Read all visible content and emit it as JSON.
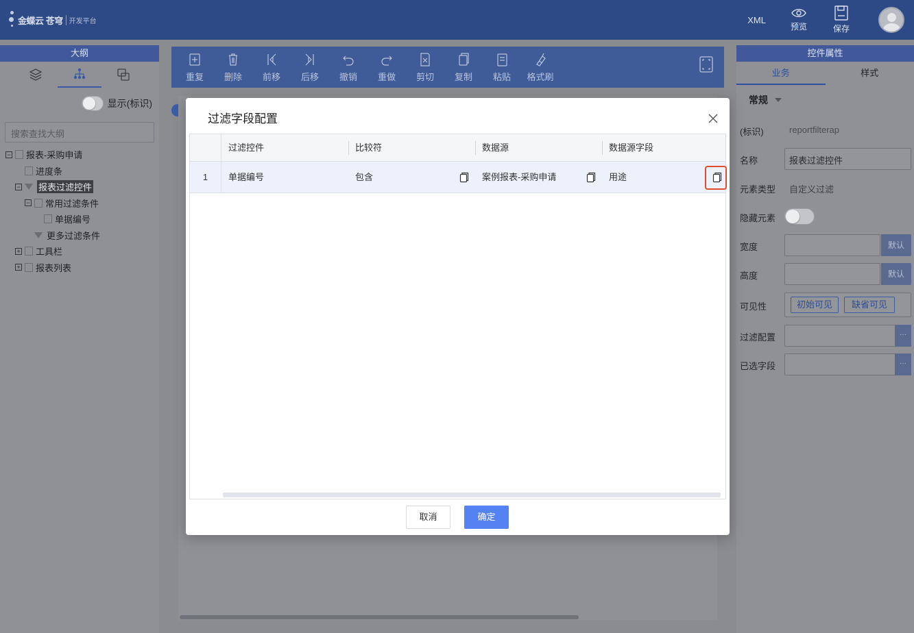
{
  "topbar": {
    "logo_brand": "金蝶云 苍穹",
    "logo_sub": "开发平台",
    "xml_label": "XML",
    "preview_label": "预览",
    "save_label": "保存"
  },
  "left_panel": {
    "title": "大纲",
    "toggle_label": "显示(标识)",
    "search_placeholder": "搜索查找大纲",
    "tree": [
      {
        "label": "报表-采购申请",
        "level": 0,
        "expander": "−",
        "icon": "form-icon"
      },
      {
        "label": "进度条",
        "level": 1,
        "expander": "",
        "icon": "progress-icon"
      },
      {
        "label": "报表过滤控件",
        "level": 1,
        "expander": "−",
        "icon": "filter-icon",
        "selected": true
      },
      {
        "label": "常用过滤条件",
        "level": 2,
        "expander": "−",
        "icon": "list-icon"
      },
      {
        "label": "单据编号",
        "level": 3,
        "expander": "",
        "icon": "field-icon"
      },
      {
        "label": "更多过滤条件",
        "level": 2,
        "expander": "",
        "icon": "filter-icon"
      },
      {
        "label": "工具栏",
        "level": 1,
        "expander": "+",
        "icon": "toolbar-icon"
      },
      {
        "label": "报表列表",
        "level": 1,
        "expander": "+",
        "icon": "list-icon"
      }
    ]
  },
  "toolbar": {
    "items": [
      "重复",
      "删除",
      "前移",
      "后移",
      "撤销",
      "重做",
      "剪切",
      "复制",
      "粘贴",
      "格式刷"
    ]
  },
  "right_panel": {
    "title": "控件属性",
    "tab_business": "业务",
    "tab_style": "样式",
    "section": "常规",
    "props": {
      "id_label": "(标识)",
      "id_value": "reportfilterap",
      "name_label": "名称",
      "name_value": "报表过滤控件",
      "type_label": "元素类型",
      "type_value": "自定义过滤",
      "hidden_label": "隐藏元素",
      "width_label": "宽度",
      "width_unit": "默认",
      "height_label": "高度",
      "height_unit": "默认",
      "visible_label": "可见性",
      "visible_initial": "初始可见",
      "visible_default": "缺省可见",
      "filter_config_label": "过滤配置",
      "selected_fields_label": "已选字段",
      "dots": "···"
    }
  },
  "modal": {
    "title": "过滤字段配置",
    "columns": [
      "过滤控件",
      "比较符",
      "数据源",
      "数据源字段"
    ],
    "rows": [
      {
        "index": "1",
        "filter_control": "单据编号",
        "comparator": "包含",
        "datasource": "案例报表-采购申请",
        "datasource_field": "用途"
      }
    ],
    "cancel_label": "取消",
    "ok_label": "确定"
  },
  "colors": {
    "topbar": "#2d4a86",
    "primary_button": "#5582f3",
    "highlight": "#e24b2d"
  }
}
